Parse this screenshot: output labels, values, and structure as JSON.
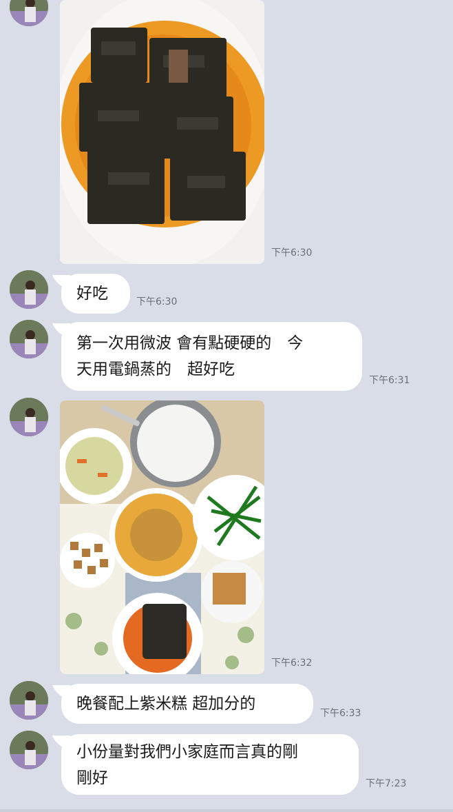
{
  "messages": [
    {
      "type": "image",
      "alt_icon": "braised-dish-photo",
      "time": "下午6:30"
    },
    {
      "type": "text",
      "text": "好吃",
      "time": "下午6:30"
    },
    {
      "type": "text",
      "line1": "第一次用微波 會有點硬硬的　今",
      "line2": "天用電鍋蒸的　超好吃",
      "time": "下午6:31"
    },
    {
      "type": "image",
      "alt_icon": "dinner-table-photo",
      "time": "下午6:32"
    },
    {
      "type": "text",
      "text": "晚餐配上紫米糕  超加分的",
      "time": "下午6:33"
    },
    {
      "type": "text",
      "line1": "小份量對我們小家庭而言真的剛",
      "line2": "剛好",
      "time": "下午7:23"
    }
  ],
  "colors": {
    "background": "#d8dde8",
    "bubble": "#ffffff",
    "timestamp": "#6a6f78"
  }
}
